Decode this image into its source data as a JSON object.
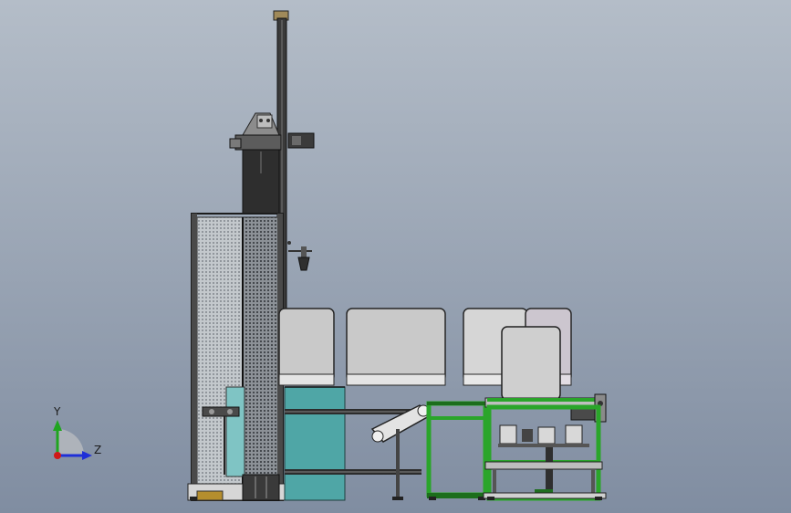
{
  "viewport": {
    "background_top": "#b4bdc8",
    "background_bottom": "#808da1"
  },
  "triad": {
    "y_label": "Y",
    "z_label": "Z",
    "y_color": "#1fa51f",
    "z_color": "#1f2fd8",
    "origin_color": "#d01818"
  },
  "colors": {
    "frame_green": "#2aa52a",
    "teal": "#4fa6a6",
    "cyan_panel": "#7fc4c4",
    "dark": "#2c2c2c",
    "box_fill": "#c9c9c9",
    "box_edge": "#262626",
    "mesh": "#9aa0a6"
  },
  "icons": {
    "triad": "coordinate-triad-icon"
  }
}
